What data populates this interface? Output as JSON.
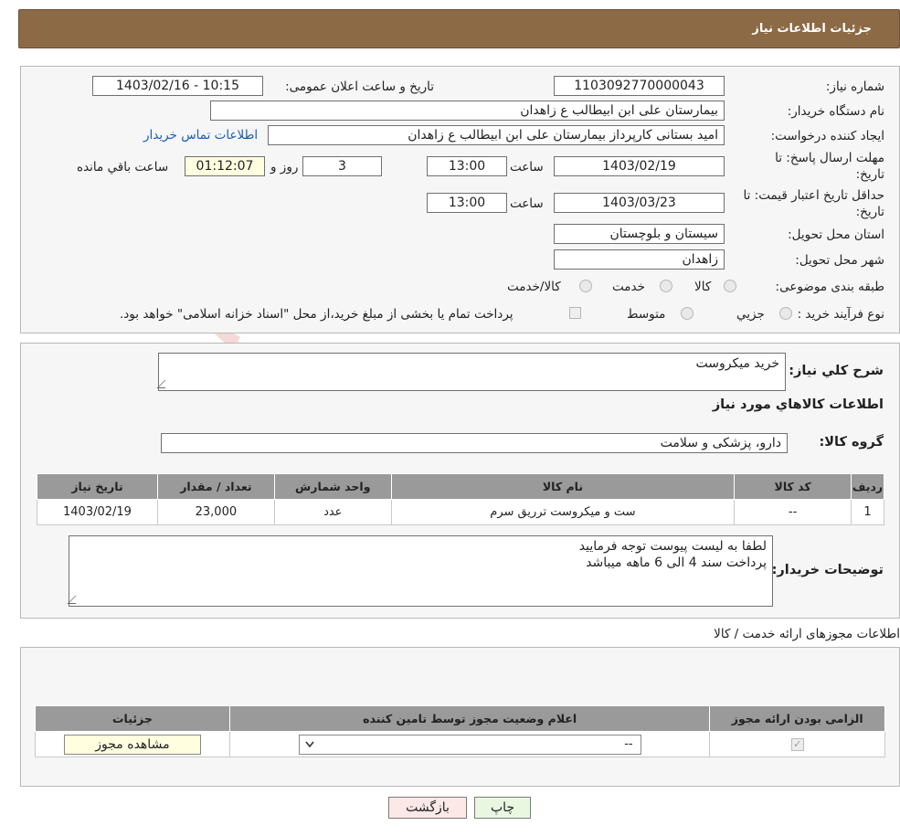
{
  "header": {
    "title": "جزئیات اطلاعات نیاز"
  },
  "watermark": {
    "text": "AriaTender.neT"
  },
  "info": {
    "need_number_label": "شماره نیاز:",
    "need_number": "1103092770000043",
    "announce_label": "تاریخ و ساعت اعلان عمومی:",
    "announce_value": "1403/02/16 - 10:15",
    "buyer_label": "نام دستگاه خریدار:",
    "buyer_value": "بیمارستان علی ابن ابیطالب  ع  زاهدان",
    "requester_label": "ایجاد کننده درخواست:",
    "requester_value": "امید بستانی کارپرداز  بیمارستان علی ابن ابیطالب  ع  زاهدان",
    "contact_link": "اطلاعات تماس خریدار",
    "deadline_label_1": "مهلت ارسال پاسخ: تا",
    "deadline_label_2": "تاریخ:",
    "deadline_date": "1403/02/19",
    "time_label": "ساعت",
    "deadline_time": "13:00",
    "days_value": "3",
    "days_label": "روز و",
    "remaining_value": "01:12:07",
    "remaining_label": "ساعت باقي مانده",
    "validity_label_1": "حداقل تاریخ اعتبار قیمت: تا",
    "validity_label_2": "تاریخ:",
    "validity_date": "1403/03/23",
    "validity_time": "13:00",
    "province_label": "استان محل تحویل:",
    "province_value": "سیستان و بلوچستان",
    "city_label": "شهر محل تحویل:",
    "city_value": "زاهدان",
    "category_label": "طبقه بندی موضوعی:",
    "category_options": [
      "کالا",
      "خدمت",
      "کالا/خدمت"
    ],
    "process_label": "نوع فرآیند خرید :",
    "process_options": [
      "جزیي",
      "متوسط"
    ],
    "process_note": "پرداخت تمام یا بخشی از مبلغ خرید،از محل \"اسناد خزانه اسلامی\" خواهد بود."
  },
  "goods": {
    "summary_label": "شرح کلي نياز:",
    "summary_value": "خريد ميكروست",
    "section_title": "اطلاعات کالاهاي مورد نياز",
    "group_label": "گروه کالا:",
    "group_value": "دارو، پزشکی و سلامت",
    "columns": [
      "رديف",
      "کد کالا",
      "نام کالا",
      "واحد شمارش",
      "تعداد / مقدار",
      "تاريخ نياز"
    ],
    "rows": [
      [
        "1",
        "--",
        "ست و ميكروست ترريق سرم",
        "عدد",
        "23,000",
        "1403/02/19"
      ]
    ],
    "buyer_notes_label": "توضيحات خريدار:",
    "buyer_notes_line1": "لطفا به ليست پيوست توجه فرماييد",
    "buyer_notes_line2": "پرداخت سند 4 الی 6 ماهه ميباشد"
  },
  "permits": {
    "title": "اطلاعات مجوزهای ارائه خدمت / کالا",
    "columns": [
      "الزامی بودن ارائه مجوز",
      "اعلام وضعیت مجوز توسط تامین کننده",
      "جزئیات"
    ],
    "select_value": "--",
    "view_button": "مشاهده مجوز"
  },
  "footer": {
    "print_button": "چاپ",
    "back_button": "بازگشت"
  },
  "colors": {
    "header_bg": "#8b6a45",
    "print_bg": "#eaf7e0",
    "back_bg": "#fde8e8",
    "link": "#1a5db3"
  }
}
